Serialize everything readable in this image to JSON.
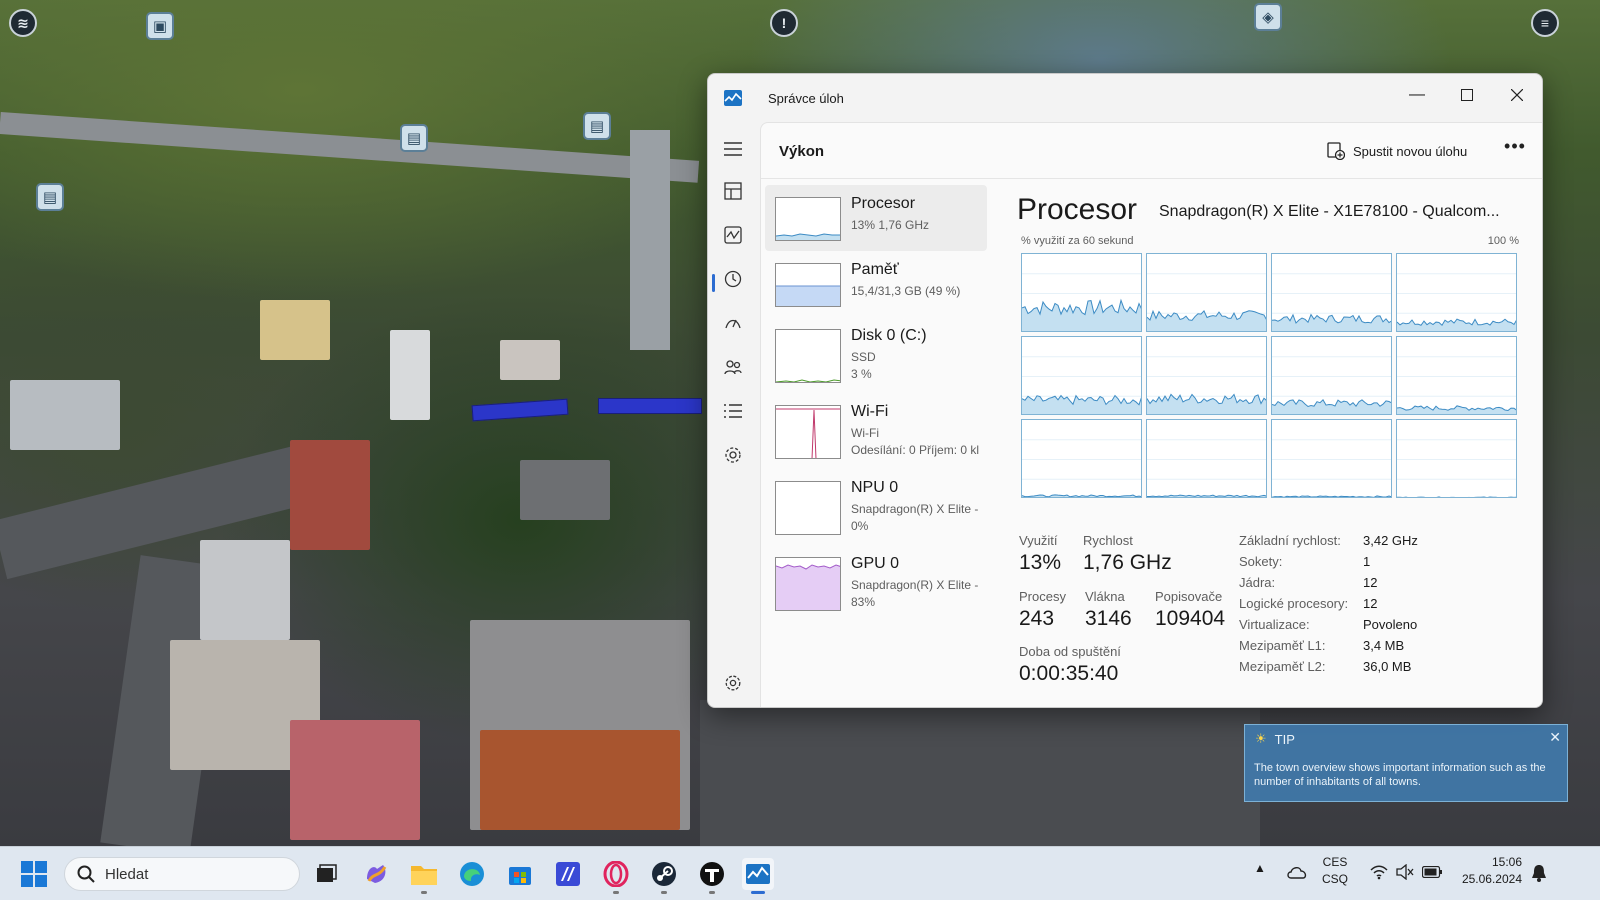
{
  "window": {
    "title": "Správce úloh",
    "page_title": "Výkon",
    "run_task_label": "Spustit novou úlohu",
    "more_label": "•••"
  },
  "perf_list": [
    {
      "name": "Procesor",
      "sub": "13%  1,76 GHz",
      "selected": true
    },
    {
      "name": "Paměť",
      "sub": "15,4/31,3 GB (49 %)"
    },
    {
      "name": "Disk 0 (C:)",
      "sub1": "SSD",
      "sub2": "3 %"
    },
    {
      "name": "Wi-Fi",
      "sub1": "Wi-Fi",
      "sub2": "Odesílání: 0  Příjem: 0 kl"
    },
    {
      "name": "NPU 0",
      "sub1": "Snapdragon(R) X Elite -",
      "sub2": "0%"
    },
    {
      "name": "GPU 0",
      "sub1": "Snapdragon(R) X Elite -",
      "sub2": "83%"
    }
  ],
  "detail": {
    "title": "Procesor",
    "cpu_name": "Snapdragon(R) X Elite - X1E78100 - Qualcom...",
    "graph_label": "% využití za 60 sekund",
    "graph_max": "100 %",
    "core_count": 12,
    "stats": {
      "util_label": "Využití",
      "util_value": "13%",
      "speed_label": "Rychlost",
      "speed_value": "1,76 GHz",
      "proc_label": "Procesy",
      "proc_value": "243",
      "threads_label": "Vlákna",
      "threads_value": "3146",
      "handles_label": "Popisovače",
      "handles_value": "109404",
      "uptime_label": "Doba od spuštění",
      "uptime_value": "0:00:35:40"
    },
    "specs": [
      {
        "key": "Základní rychlost:",
        "value": "3,42 GHz"
      },
      {
        "key": "Sokety:",
        "value": "1"
      },
      {
        "key": "Jádra:",
        "value": "12"
      },
      {
        "key": "Logické procesory:",
        "value": "12"
      },
      {
        "key": "Virtualizace:",
        "value": "Povoleno"
      },
      {
        "key": "Mezipaměť L1:",
        "value": "3,4 MB"
      },
      {
        "key": "Mezipaměť L2:",
        "value": "36,0 MB"
      }
    ]
  },
  "tip": {
    "heading": "TIP",
    "text": "The town overview shows important information such as the number of inhabitants of all towns."
  },
  "taskbar": {
    "search_placeholder": "Hledat",
    "lang_line1": "CES",
    "lang_line2": "CSQ",
    "time": "15:06",
    "date": "25.06.2024",
    "apps": [
      "task-view",
      "copilot",
      "file-explorer",
      "edge",
      "store",
      "visual-studio",
      "opera",
      "steam",
      "t-app",
      "task-manager"
    ]
  },
  "colors": {
    "accent": "#2c6cd1",
    "cpu_graph": "#7fb3d4",
    "cpu_fill": "#c4e0f1",
    "mem_fill": "#c5d9f5",
    "disk_line": "#4c9a2a",
    "wifi_line": "#c0396b",
    "gpu_fill": "#e5cdf5",
    "tip_bg": "#4078aa"
  }
}
